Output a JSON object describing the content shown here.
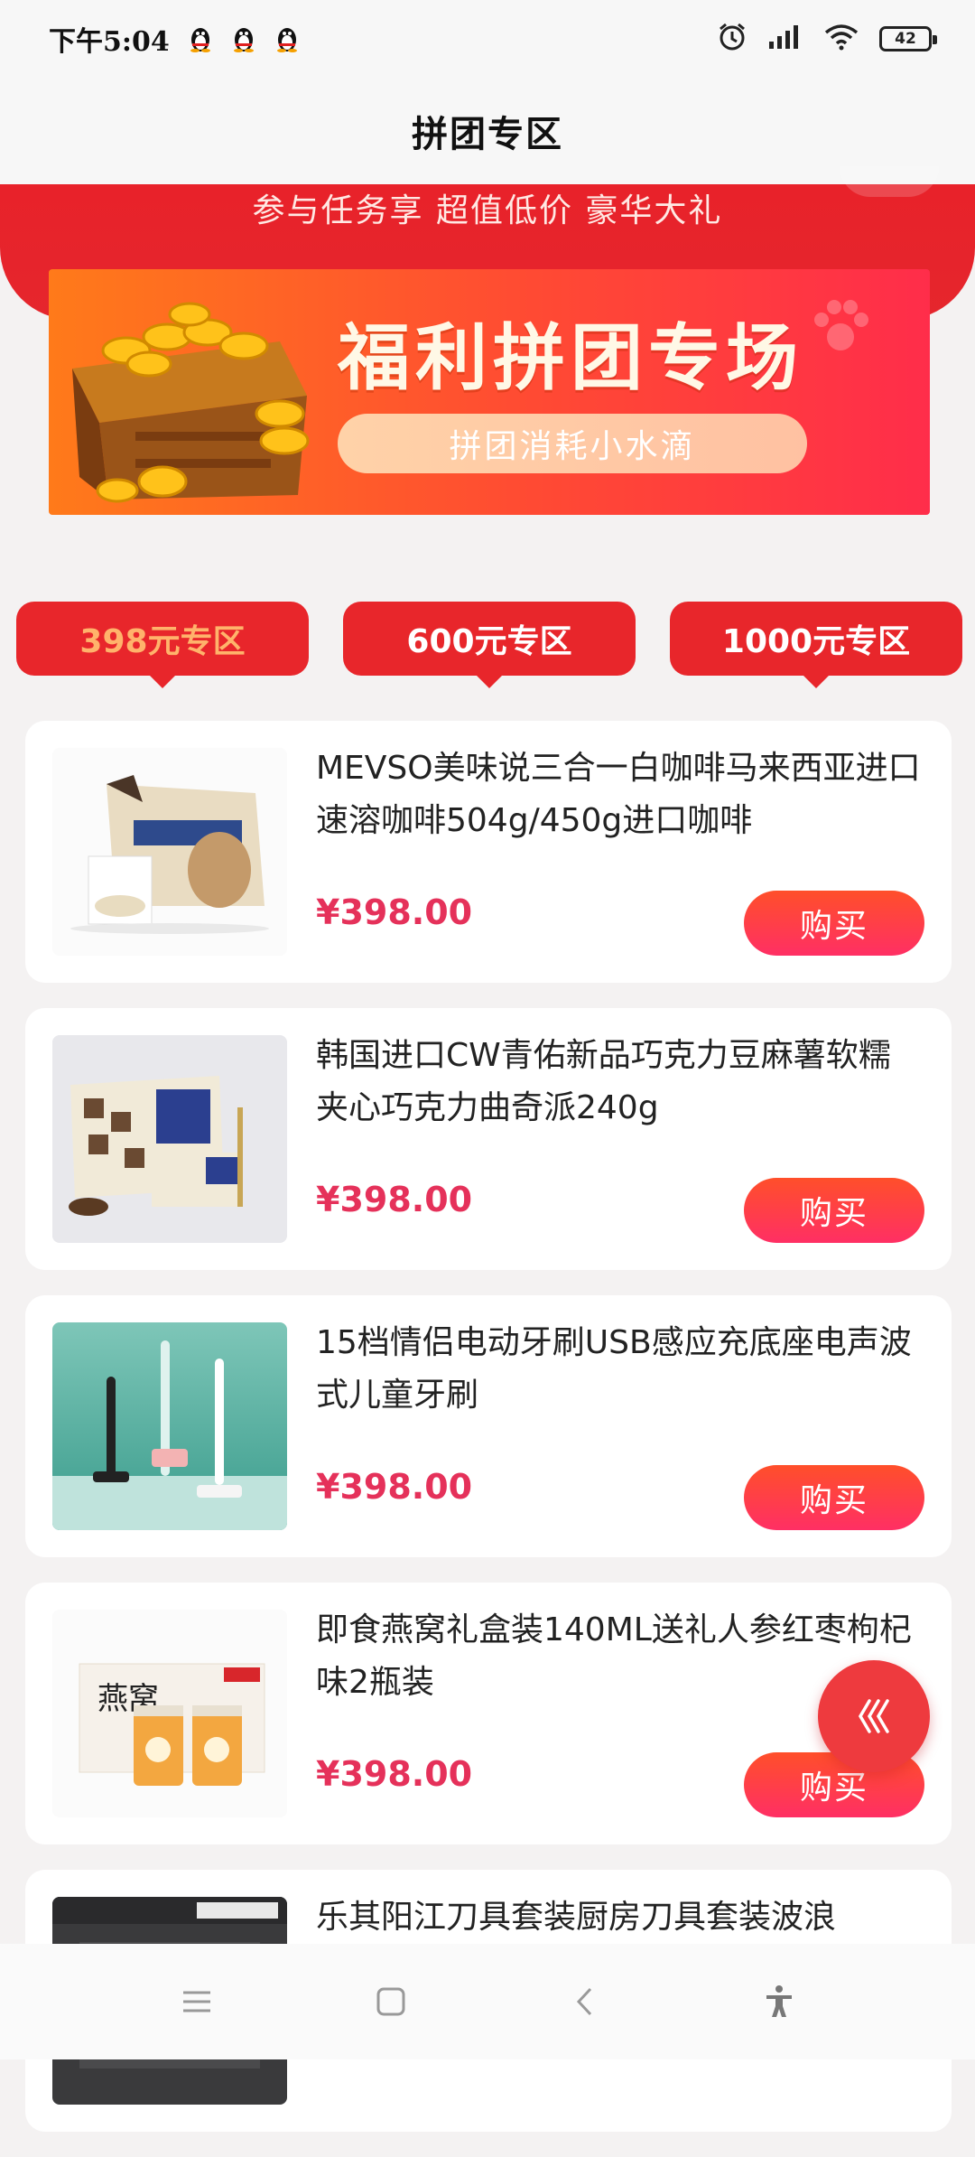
{
  "status_bar": {
    "time": "下午5:04",
    "notification_icons": [
      "qq-penguin-icon",
      "qq-penguin-icon",
      "qq-penguin-icon"
    ],
    "right_icons": [
      "alarm-icon",
      "signal-icon",
      "wifi-icon"
    ],
    "battery": "42"
  },
  "header": {
    "title": "拼团专区"
  },
  "promo": {
    "slogan": "参与任务享 超值低价 豪华大礼",
    "banner_title": "福利拼团专场",
    "banner_subtitle": "拼团消耗小水滴"
  },
  "tabs": [
    {
      "label": "398元专区",
      "active": true
    },
    {
      "label": "600元专区",
      "active": false
    },
    {
      "label": "1000元专区",
      "active": false
    }
  ],
  "products": [
    {
      "name": "MEVSO美味说三合一白咖啡马来西亚进口速溶咖啡504g/450g进口咖啡",
      "price": "¥398.00",
      "buy_label": "购买",
      "image": "coffee-bag"
    },
    {
      "name": "韩国进口CW青佑新品巧克力豆麻薯软糯夹心巧克力曲奇派240g",
      "price": "¥398.00",
      "buy_label": "购买",
      "image": "cookie-box"
    },
    {
      "name": "15档情侣电动牙刷USB感应充底座电声波式儿童牙刷",
      "price": "¥398.00",
      "buy_label": "购买",
      "image": "toothbrush"
    },
    {
      "name": "即食燕窝礼盒装140ML送礼人参红枣枸杞味2瓶装",
      "price": "¥398.00",
      "buy_label": "购买",
      "image": "birds-nest"
    },
    {
      "name": "乐其阳江刀具套装厨房刀具套装波浪",
      "price": "",
      "buy_label": "",
      "image": "knife-set"
    }
  ],
  "colors": {
    "primary_red": "#e8262b",
    "price": "#e5315a",
    "active_tab_text": "#ffb36b"
  },
  "fab": {
    "icon": "chevrons-left-icon"
  },
  "nav_bar": {
    "icons": [
      "menu-icon",
      "home-square-icon",
      "back-icon",
      "accessibility-icon"
    ]
  }
}
